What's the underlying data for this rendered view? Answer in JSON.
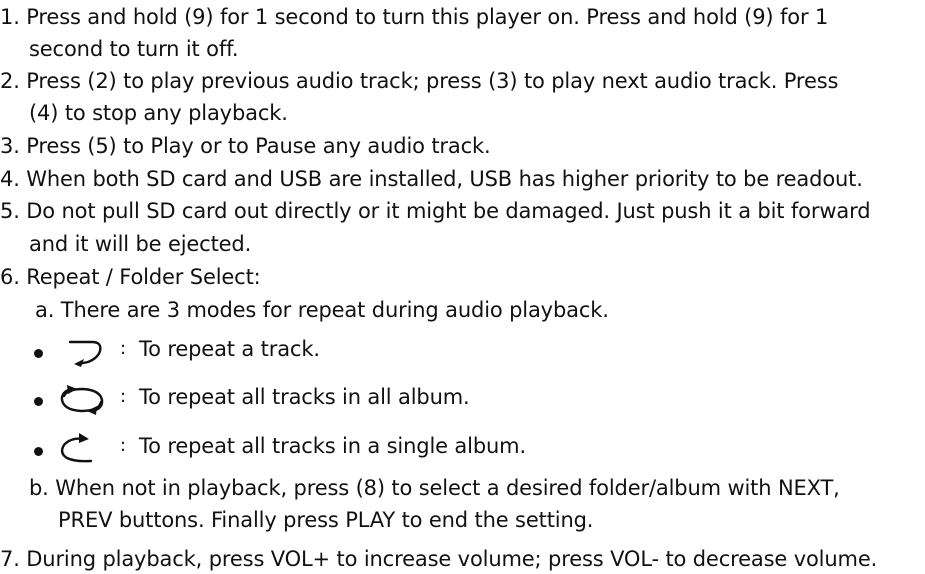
{
  "items": [
    {
      "line1": "1. Press and hold (9) for 1 second to turn this player on. Press and hold (9) for 1",
      "line2": "second to turn it off."
    },
    {
      "line1": "2. Press (2) to play previous audio track; press (3) to play next audio track. Press",
      "line2": "(4) to stop any playback."
    },
    {
      "line1": "3. Press (5) to Play or to Pause any audio track."
    },
    {
      "line1": "4. When both SD card and USB are installed, USB has higher priority to be readout."
    },
    {
      "line1": "5. Do not pull SD card out directly or it might be damaged. Just push it a bit forward",
      "line2": "and it will be ejected."
    },
    {
      "line1": "6. Repeat / Folder Select:"
    },
    {
      "line1": "7. During playback, press VOL+ to increase volume; press VOL- to decrease volume."
    }
  ],
  "sub_a": "a. There are 3 modes for repeat during audio playback.",
  "repeat_modes": [
    {
      "icon": "repeat-one-icon",
      "colon": ":",
      "text": "To repeat a track."
    },
    {
      "icon": "repeat-all-icon",
      "colon": ":",
      "text": "To repeat all tracks in all album."
    },
    {
      "icon": "repeat-album-icon",
      "colon": ":",
      "text": "To repeat all tracks in a single album."
    }
  ],
  "sub_b": {
    "line1": "b. When not in playback, press (8) to select a desired folder/album with NEXT,",
    "line2": "PREV buttons. Finally press PLAY to end the setting."
  }
}
